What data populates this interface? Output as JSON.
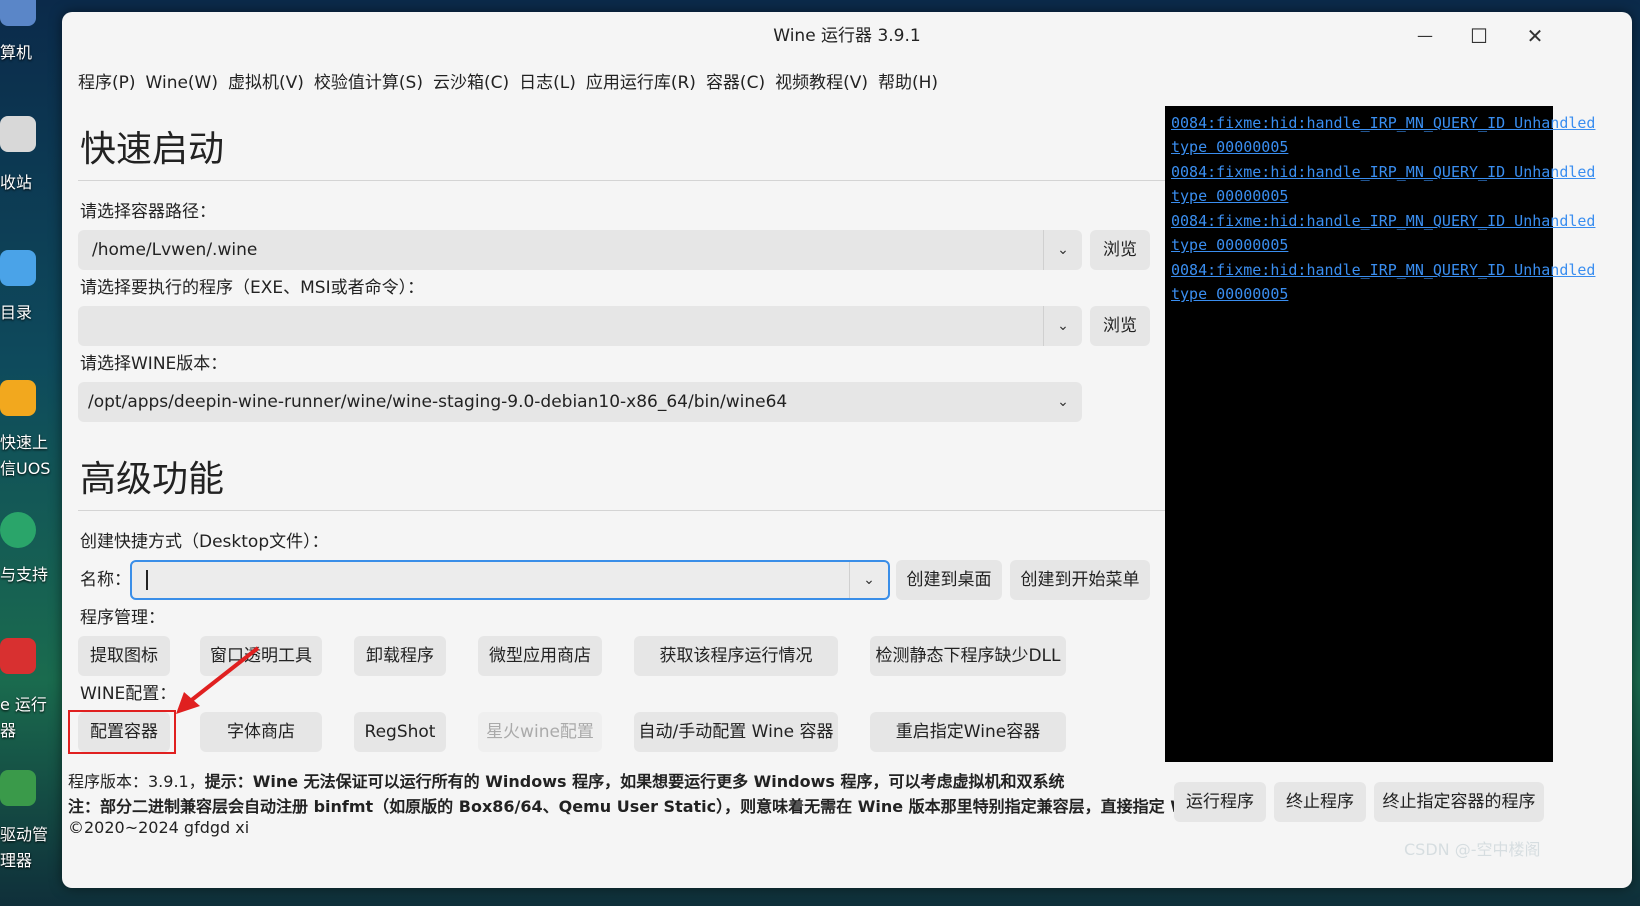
{
  "desktop": {
    "labels": [
      "算机",
      "收站",
      "目录",
      "快速上",
      "信UOS",
      "与支持",
      "e 运行",
      "器",
      "驱动管",
      "理器"
    ]
  },
  "window": {
    "title": "Wine 运行器 3.9.1",
    "controls": {
      "minimize": "—",
      "maximize": "☐",
      "close": "✕"
    }
  },
  "menu": [
    "程序(P)",
    "Wine(W)",
    "虚拟机(V)",
    "校验值计算(S)",
    "云沙箱(C)",
    "日志(L)",
    "应用运行库(R)",
    "容器(C)",
    "视频教程(V)",
    "帮助(H)"
  ],
  "quick_start": {
    "heading": "快速启动",
    "container_label": "请选择容器路径：",
    "container_value": "/home/Lvwen/.wine",
    "program_label": "请选择要执行的程序（EXE、MSI或者命令）：",
    "program_value": "",
    "wine_label": "请选择WINE版本：",
    "wine_value": "/opt/apps/deepin-wine-runner/wine/wine-staging-9.0-debian10-x86_64/bin/wine64",
    "browse": "浏览"
  },
  "advanced": {
    "heading": "高级功能",
    "shortcut_label": "创建快捷方式（Desktop文件）：",
    "name_label": "名称：",
    "name_value": "",
    "create_desktop": "创建到桌面",
    "create_menu": "创建到开始菜单",
    "program_mgmt_label": "程序管理：",
    "program_mgmt_buttons": [
      "提取图标",
      "窗口透明工具",
      "卸载程序",
      "微型应用商店",
      "获取该程序运行情况",
      "检测静态下程序缺少DLL"
    ],
    "wine_config_label": "WINE配置：",
    "wine_config_buttons": [
      "配置容器",
      "字体商店",
      "RegShot",
      "星火wine配置",
      "自动/手动配置 Wine 容器",
      "重启指定Wine容器"
    ]
  },
  "console": {
    "lines": [
      "0084:fixme:hid:handle_IRP_MN_QUERY_ID Unhandled",
      "type 00000005",
      "0084:fixme:hid:handle_IRP_MN_QUERY_ID Unhandled",
      "type 00000005",
      "0084:fixme:hid:handle_IRP_MN_QUERY_ID Unhandled",
      "type 00000005",
      "0084:fixme:hid:handle_IRP_MN_QUERY_ID Unhandled",
      "type 00000005"
    ],
    "link_color": "#3a8ef0"
  },
  "footer": {
    "line1_prefix": "程序版本：3.9.1，",
    "line1_bold": "提示：Wine 无法保证可以运行所有的 Windows 程序，如果想要运行更多 Windows 程序，可以考虑虚拟机和双系统",
    "line2_bold": "注：部分二进制兼容层会自动注册 binfmt（如原版的 Box86/64、Qemu User Static），则意味着无需在 Wine 版本那里特别指定兼容层，直接指定 Wine 即可",
    "line3": "©2020~2024 gfdgd xi",
    "run": "运行程序",
    "stop": "终止程序",
    "stop_container": "终止指定容器的程序"
  },
  "watermark": "CSDN @-空中楼阁",
  "annotation_color": "#e02020"
}
